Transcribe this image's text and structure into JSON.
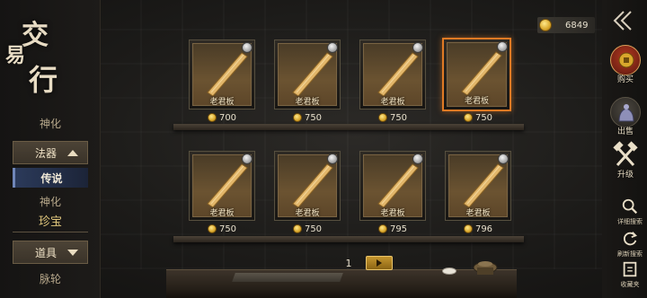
{
  "title": {
    "chars": [
      "交",
      "易",
      "行"
    ]
  },
  "left_nav": {
    "item_shenhua_top": "神化",
    "faqi_label": "法器",
    "chuanshuo_label": "传说",
    "shenhua_label": "神化",
    "zhenbao_label": "珍宝",
    "daoju_label": "道具",
    "maiilun_label": "脉轮"
  },
  "currency": {
    "amount": "6849"
  },
  "items_row1": [
    {
      "name": "老君板",
      "price": "700",
      "selected": false
    },
    {
      "name": "老君板",
      "price": "750",
      "selected": false
    },
    {
      "name": "老君板",
      "price": "750",
      "selected": false
    },
    {
      "name": "老君板",
      "price": "750",
      "selected": true
    }
  ],
  "items_row2": [
    {
      "name": "老君板",
      "price": "750",
      "selected": false
    },
    {
      "name": "老君板",
      "price": "750",
      "selected": false
    },
    {
      "name": "老君板",
      "price": "795",
      "selected": false
    },
    {
      "name": "老君板",
      "price": "796",
      "selected": false
    }
  ],
  "right_nav": {
    "buy_label": "购买",
    "sell_label": "出售",
    "upgrade_label": "升级",
    "detail_search_label": "详细搜索",
    "refresh_label": "刷新搜索",
    "favorites_label": "收藏夹"
  },
  "pagination": {
    "current_page": "1"
  },
  "colors": {
    "accent_selected": "#e07a24",
    "coin": "#d9a72c",
    "active_tab": "#2b3a5a"
  }
}
